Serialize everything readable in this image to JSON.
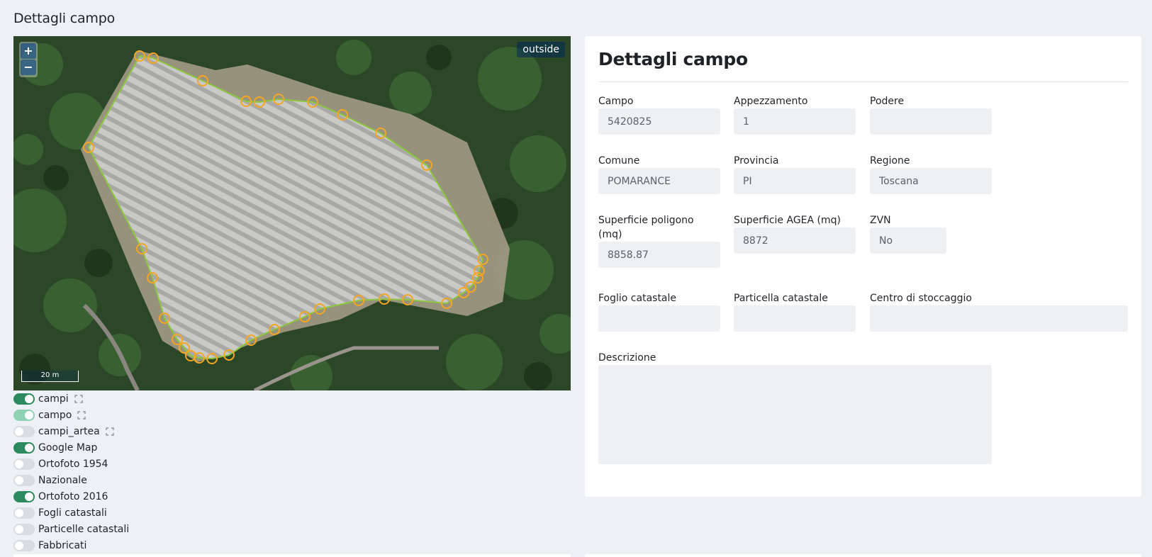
{
  "page": {
    "title": "Dettagli campo"
  },
  "map": {
    "zoom_in_label": "+",
    "zoom_out_label": "−",
    "status_badge": "outside",
    "scale_label": "20 m",
    "polygon_color": "#8dc63f",
    "vertex_color": "#f5a623"
  },
  "layers": [
    {
      "label": "campi",
      "state": "on",
      "expandable": true
    },
    {
      "label": "campo",
      "state": "on-light",
      "expandable": true
    },
    {
      "label": "campi_artea",
      "state": "off",
      "expandable": true
    },
    {
      "label": "Google Map",
      "state": "on",
      "expandable": false
    },
    {
      "label": "Ortofoto 1954",
      "state": "off",
      "expandable": false
    },
    {
      "label": "Nazionale",
      "state": "off",
      "expandable": false
    },
    {
      "label": "Ortofoto 2016",
      "state": "on",
      "expandable": false
    },
    {
      "label": "Fogli catastali",
      "state": "off",
      "expandable": false
    },
    {
      "label": "Particelle catastali",
      "state": "off",
      "expandable": false
    },
    {
      "label": "Fabbricati",
      "state": "off",
      "expandable": false
    }
  ],
  "details": {
    "title": "Dettagli campo",
    "fields": {
      "campo": {
        "label": "Campo",
        "value": "5420825"
      },
      "appezzamento": {
        "label": "Appezzamento",
        "value": "1"
      },
      "podere": {
        "label": "Podere",
        "value": ""
      },
      "comune": {
        "label": "Comune",
        "value": "POMARANCE"
      },
      "provincia": {
        "label": "Provincia",
        "value": "PI"
      },
      "regione": {
        "label": "Regione",
        "value": "Toscana"
      },
      "superficie_poligono": {
        "label": "Superficie poligono (mq)",
        "value": "8858.87"
      },
      "superficie_agea": {
        "label": "Superficie AGEA (mq)",
        "value": "8872"
      },
      "zvn": {
        "label": "ZVN",
        "value": "No"
      },
      "foglio": {
        "label": "Foglio catastale",
        "value": ""
      },
      "particella": {
        "label": "Particella catastale",
        "value": ""
      },
      "centro": {
        "label": "Centro di stoccaggio",
        "value": ""
      },
      "descrizione": {
        "label": "Descrizione",
        "value": ""
      }
    }
  },
  "colors": {
    "toggle_on": "#2d8a5e",
    "toggle_on_light": "#8fd1b3",
    "toggle_off": "#d9dde2",
    "background": "#edf0f4"
  }
}
